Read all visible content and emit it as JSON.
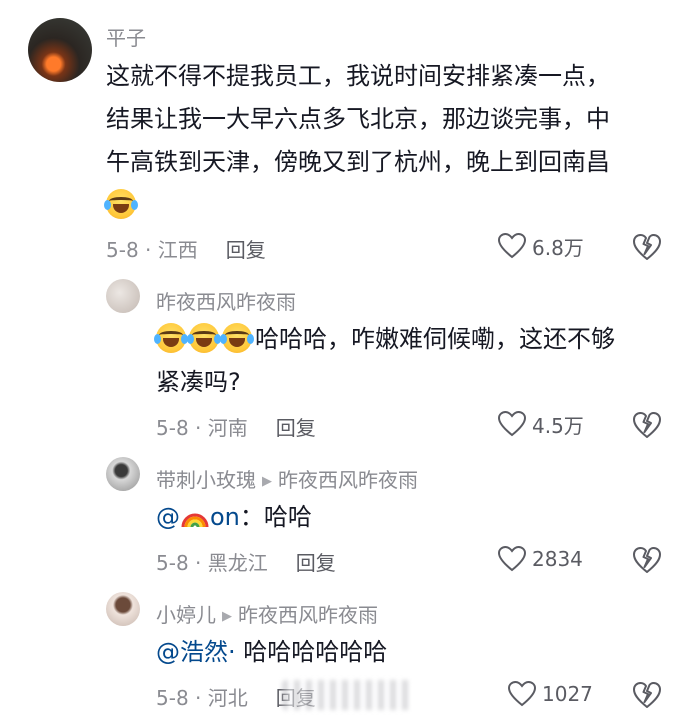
{
  "comments": [
    {
      "name": "平子",
      "lines": [
        "这就不得不提我员工，我说时间安排紧凑一点，",
        "结果让我一大早六点多飞北京，那边谈完事，中",
        "午高铁到天津，傍晚又到了杭州，晚上到回南昌"
      ],
      "emoji_icon": "crying-laughing-emoji",
      "meta": "5-8 · 江西",
      "reply_label": "回复",
      "likes": "6.8万"
    },
    {
      "name": "昨夜西风昨夜雨",
      "lines": [
        "哈哈哈，咋嫩难伺候嘞，这还不够",
        "紧凑吗?"
      ],
      "emoji_icon": "crying-laughing-emoji",
      "meta": "5-8 · 河南",
      "reply_label": "回复",
      "likes": "4.5万"
    },
    {
      "name": "带刺小玫瑰",
      "reply_to": "昨夜西风昨夜雨",
      "mention_prefix": "@",
      "mention_suffix": "on",
      "mention_icon": "rainbow-icon",
      "text": "：哈哈",
      "meta": "5-8 · 黑龙江",
      "reply_label": "回复",
      "likes": "2834"
    },
    {
      "name": "小婷儿",
      "reply_to": "昨夜西风昨夜雨",
      "mention": "@浩然·",
      "text": " 哈哈哈哈哈哈",
      "meta": "5-8 · 河北",
      "reply_label": "回复",
      "likes": "1027"
    }
  ],
  "colors": {
    "text": "#161823",
    "secondary": "#8a8b91",
    "mention": "#04498d",
    "icon": "#5a5b62"
  }
}
